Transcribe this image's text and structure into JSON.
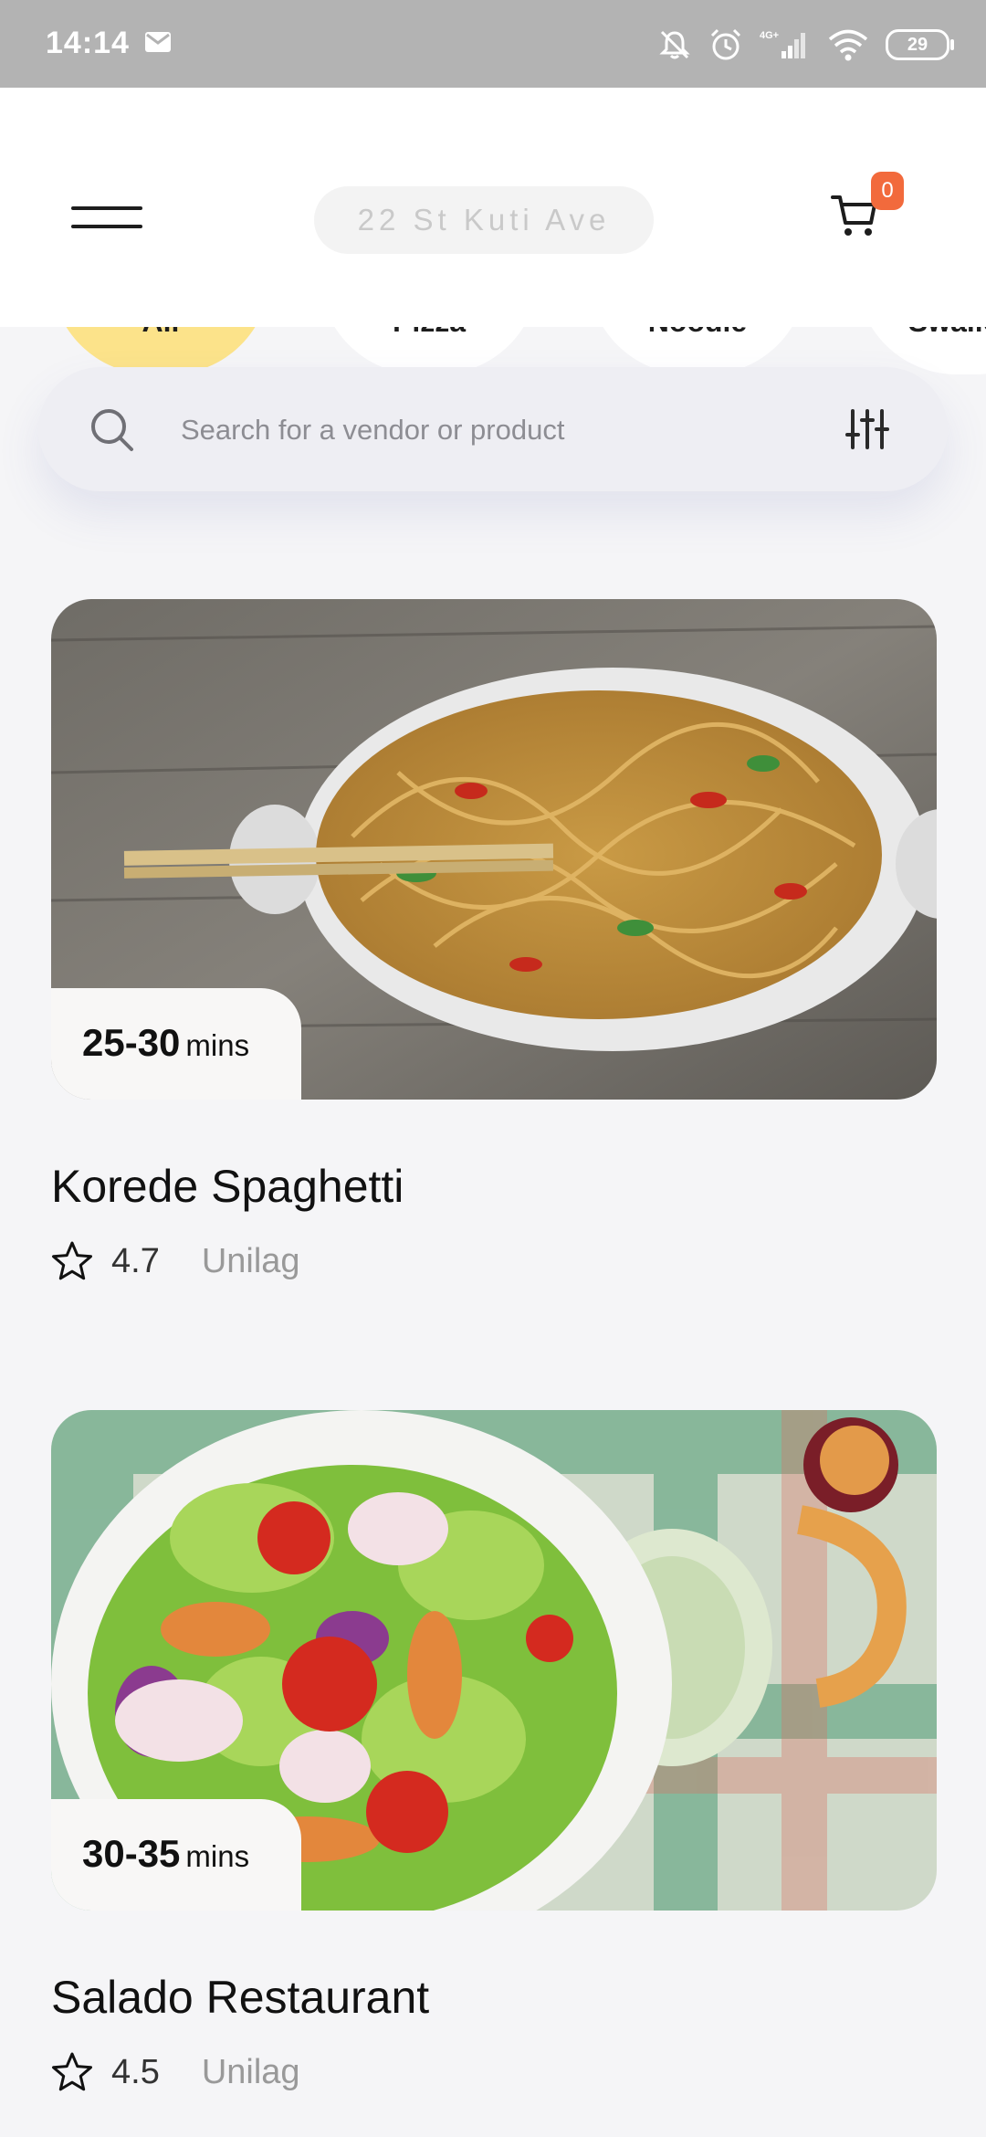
{
  "status_bar": {
    "time": "14:14",
    "battery": "29"
  },
  "header": {
    "address": "22 St Kuti Ave",
    "cart_count": "0"
  },
  "categories": [
    {
      "label": "All",
      "active": true
    },
    {
      "label": "Pizza",
      "active": false
    },
    {
      "label": "Noodle",
      "active": false
    },
    {
      "label": "Swallow",
      "active": false
    }
  ],
  "search": {
    "placeholder": "Search for a vendor or product"
  },
  "vendors": [
    {
      "eta": "25-30",
      "eta_unit": "mins",
      "name": "Korede Spaghetti",
      "rating": "4.7",
      "location": "Unilag"
    },
    {
      "eta": "30-35",
      "eta_unit": "mins",
      "name": "Salado Restaurant",
      "rating": "4.5",
      "location": "Unilag"
    }
  ],
  "colors": {
    "accent": "#f26a3c",
    "active_chip": "#fce38a"
  }
}
